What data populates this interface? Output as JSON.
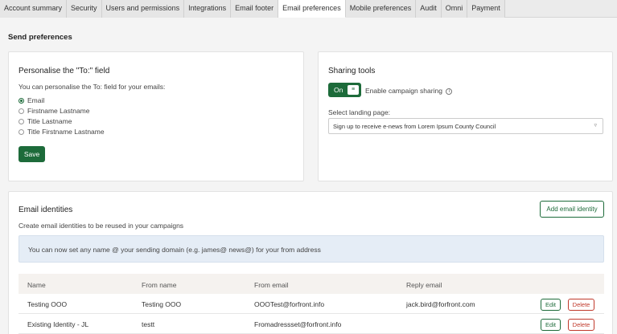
{
  "tabs": [
    {
      "label": "Account summary",
      "active": false
    },
    {
      "label": "Security",
      "active": false
    },
    {
      "label": "Users and permissions",
      "active": false
    },
    {
      "label": "Integrations",
      "active": false
    },
    {
      "label": "Email footer",
      "active": false
    },
    {
      "label": "Email preferences",
      "active": true
    },
    {
      "label": "Mobile preferences",
      "active": false
    },
    {
      "label": "Audit",
      "active": false
    },
    {
      "label": "Omni",
      "active": false
    },
    {
      "label": "Payment",
      "active": false
    }
  ],
  "page_title": "Send preferences",
  "personalise": {
    "title": "Personalise the \"To:\" field",
    "intro": "You can personalise the To: field for your emails:",
    "options": [
      {
        "label": "Email",
        "selected": true
      },
      {
        "label": "Firstname Lastname",
        "selected": false
      },
      {
        "label": "Title Lastname",
        "selected": false
      },
      {
        "label": "Title Firstname Lastname",
        "selected": false
      }
    ],
    "save_label": "Save"
  },
  "sharing": {
    "title": "Sharing tools",
    "toggle_label": "On",
    "toggle_state": "on",
    "enable_label": "Enable campaign sharing",
    "info_icon": "i",
    "landing_label": "Select landing page:",
    "landing_value": "Sign up to receive e-news from Lorem Ipsum County Council",
    "caret_icon": "chevron-down-icon"
  },
  "identities": {
    "title": "Email identities",
    "add_label": "Add email identity",
    "subtitle": "Create email identities to be reused in your campaigns",
    "banner": "You can now set any name @ your sending domain (e.g. james@ news@) for your from address",
    "columns": [
      "Name",
      "From name",
      "From email",
      "Reply email"
    ],
    "rows": [
      {
        "name": "Testing OOO",
        "from_name": "Testing OOO",
        "from_email": "OOOTest@forfront.info",
        "reply_email": "jack.bird@forfront.com",
        "edit": "Edit",
        "delete": "Delete"
      },
      {
        "name": "Existing Identity - JL",
        "from_name": "testt",
        "from_email": "Fromadressset@forfront.info",
        "reply_email": "",
        "edit": "Edit",
        "delete": "Delete"
      }
    ]
  },
  "colors": {
    "accent": "#1d6b3a",
    "danger": "#c0392b",
    "banner": "#e5edf6"
  }
}
